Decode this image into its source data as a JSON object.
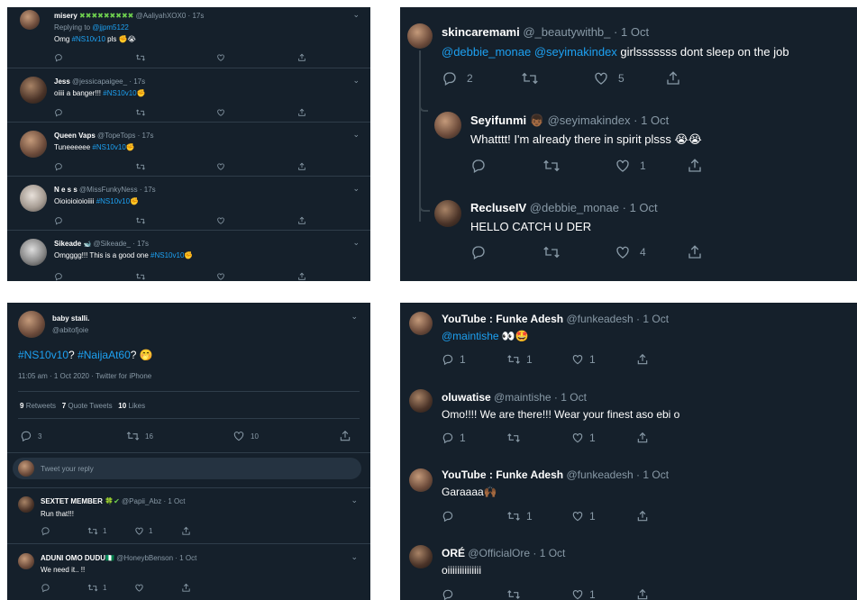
{
  "panel1": {
    "tweets": [
      {
        "name": "misery",
        "deco": "✖✖✖✖✖✖✖✖✖",
        "handle": "@AaliyahXOX0",
        "time": "17s",
        "replying_label": "Replying to",
        "replying_handle": "@jjpm5122",
        "text_a": "Omg ",
        "hashtag": "#NS10v10",
        "text_b": " pls ",
        "emoji": "✊😭"
      },
      {
        "name": "Jess",
        "handle": "@jessicapaigee_",
        "time": "17s",
        "text_a": "oiiii a banger!!! ",
        "hashtag": "#NS10v10",
        "emoji": "✊"
      },
      {
        "name": "Queen Vaps",
        "handle": "@TopeTops",
        "time": "17s",
        "text_a": "Tuneeeeee ",
        "hashtag": "#NS10v10",
        "emoji": "✊"
      },
      {
        "name": "N e s s",
        "handle": "@MissFunkyNess",
        "time": "17s",
        "text_a": "Oioioioioioiiii ",
        "hashtag": "#NS10v10",
        "emoji": "✊"
      },
      {
        "name": "Sikeade",
        "deco": "🐋",
        "handle": "@Sikeade_",
        "time": "17s",
        "text_a": "Omgggg!!! This is a good one ",
        "hashtag": "#NS10v10",
        "emoji": "✊"
      }
    ]
  },
  "panel2": {
    "main": {
      "name": "skincaremami",
      "handle": "@_beautywithb_",
      "time": "1 Oct",
      "mention1": "@debbie_monae",
      "mention2": "@seyimakindex",
      "text": " girlsssssss dont sleep on the job",
      "replies": "2",
      "likes": "5"
    },
    "reply1": {
      "name": "Seyifunmi",
      "deco": "👦🏾",
      "handle": "@seyimakindex",
      "time": "1 Oct",
      "text": "Whatttt! I'm already there in spirit plsss ",
      "emoji": "😭😭",
      "likes": "1"
    },
    "reply2": {
      "name": "RecluseIV",
      "handle": "@debbie_monae",
      "time": "1 Oct",
      "text": "HELLO CATCH U DER",
      "likes": "4"
    }
  },
  "panel3": {
    "name": "baby stalli.",
    "handle": "@abitofjoie",
    "hashtag1": "#NS10v10",
    "q1": "? ",
    "hashtag2": "#NaijaAt60",
    "q2": "? ",
    "emoji": "🤭",
    "meta": "11:05 am · 1 Oct 2020 · Twitter for iPhone",
    "stats": {
      "retweets_num": "9",
      "retweets_label": "Retweets",
      "quotes_num": "7",
      "quotes_label": "Quote Tweets",
      "likes_num": "10",
      "likes_label": "Likes"
    },
    "actions": {
      "replies": "3",
      "retweets": "16",
      "likes": "10"
    },
    "reply_placeholder": "Tweet your reply",
    "replies": [
      {
        "name": "SEXTET MEMBER",
        "deco": "🍀✔",
        "handle": "@Papii_Abz",
        "time": "1 Oct",
        "text": "Run that!!!",
        "retweets": "1",
        "likes": "1"
      },
      {
        "name": "ADUNI OMO DUDU",
        "deco": "🇳🇬",
        "handle": "@HoneybBenson",
        "time": "1 Oct",
        "text": "We need it.. !!",
        "retweets": "1",
        "likes": ""
      }
    ]
  },
  "panel4": {
    "tweets": [
      {
        "name": "YouTube : Funke Adesh",
        "handle": "@funkeadesh",
        "time": "1 Oct",
        "mention": "@maintishe",
        "emoji": "👀🤩",
        "replies": "1",
        "retweets": "1",
        "likes": "1"
      },
      {
        "name": "oluwatise",
        "handle": "@maintishe",
        "time": "1 Oct",
        "text": "Omo!!!! We are there!!! Wear your finest aso ebi o",
        "replies": "1",
        "retweets": "",
        "likes": "1"
      },
      {
        "name": "YouTube : Funke Adesh",
        "handle": "@funkeadesh",
        "time": "1 Oct",
        "text": "Garaaaa",
        "emoji": "🙌🏾",
        "replies": "",
        "retweets": "1",
        "likes": "1"
      },
      {
        "name": "ORÉ",
        "handle": "@OfficialOre",
        "time": "1 Oct",
        "text": "oiiiiiiiiiiiiii",
        "replies": "",
        "retweets": "",
        "likes": "1"
      }
    ]
  },
  "colors": {
    "background": "#15202b",
    "text": "#ffffff",
    "muted": "#8899a6",
    "link": "#1da1f2",
    "divider": "#2f3d4a"
  },
  "icons": [
    "reply-icon",
    "retweet-icon",
    "like-icon",
    "share-icon",
    "chevron-down-icon"
  ]
}
